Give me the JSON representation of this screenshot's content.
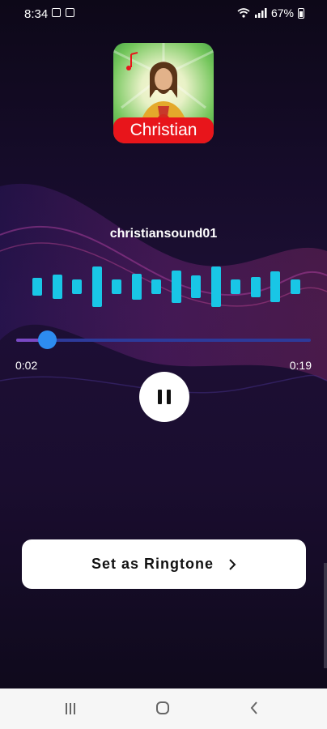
{
  "status_bar": {
    "time": "8:34",
    "battery": "67%"
  },
  "app": {
    "logo_label": "Christian"
  },
  "player": {
    "track_title": "christiansound01",
    "current_time": "0:02",
    "total_time": "0:19",
    "progress": 0.105,
    "state": "playing",
    "waveform_levels": [
      0.45,
      0.6,
      0.35,
      1.0,
      0.35,
      0.65,
      0.35,
      0.8,
      0.55,
      1.0,
      0.35,
      0.5,
      0.75,
      0.35
    ]
  },
  "actions": {
    "set_ringtone_label": "Set as Ringtone"
  },
  "colors": {
    "waveform": "#19c6e6",
    "progress_fill": "#7a49c4",
    "progress_track": "#2d3a9a",
    "knob": "#2d8cf0",
    "logo_banner": "#e8151b"
  },
  "icons": {
    "play_button": "pause-icon",
    "ringtone_button": "chevron-right-icon",
    "nav": [
      "recent-apps-icon",
      "home-icon",
      "back-icon"
    ]
  }
}
